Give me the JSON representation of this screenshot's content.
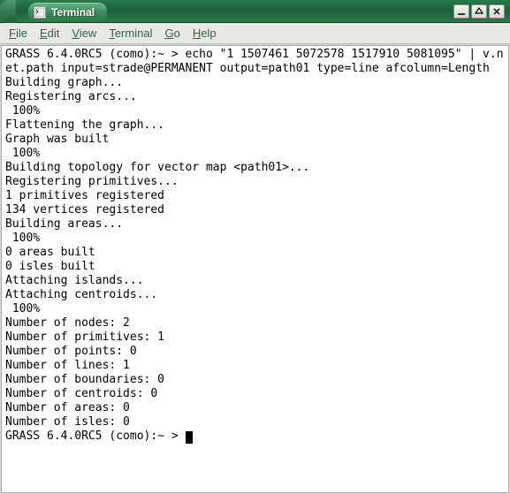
{
  "window": {
    "title": "Terminal"
  },
  "menubar": {
    "file": "File",
    "edit": "Edit",
    "view": "View",
    "terminal": "Terminal",
    "go": "Go",
    "help": "Help"
  },
  "terminal": {
    "line0": "GRASS 6.4.0RC5 (como):~ > echo \"1 1507461 5072578 1517910 5081095\" | v.net.path input=strade@PERMANENT output=path01 type=line afcolumn=Length",
    "line1": "Building graph...",
    "line2": "Registering arcs...",
    "line3": " 100%",
    "line4": "Flattening the graph...",
    "line5": "Graph was built",
    "line6": " 100%",
    "line7": "Building topology for vector map <path01>...",
    "line8": "Registering primitives...",
    "line9": "1 primitives registered",
    "line10": "134 vertices registered",
    "line11": "Building areas...",
    "line12": " 100%",
    "line13": "0 areas built",
    "line14": "0 isles built",
    "line15": "Attaching islands...",
    "line16": "Attaching centroids...",
    "line17": " 100%",
    "line18": "Number of nodes: 2",
    "line19": "Number of primitives: 1",
    "line20": "Number of points: 0",
    "line21": "Number of lines: 1",
    "line22": "Number of boundaries: 0",
    "line23": "Number of centroids: 0",
    "line24": "Number of areas: 0",
    "line25": "Number of isles: 0",
    "prompt": "GRASS 6.4.0RC5 (como):~ > "
  }
}
